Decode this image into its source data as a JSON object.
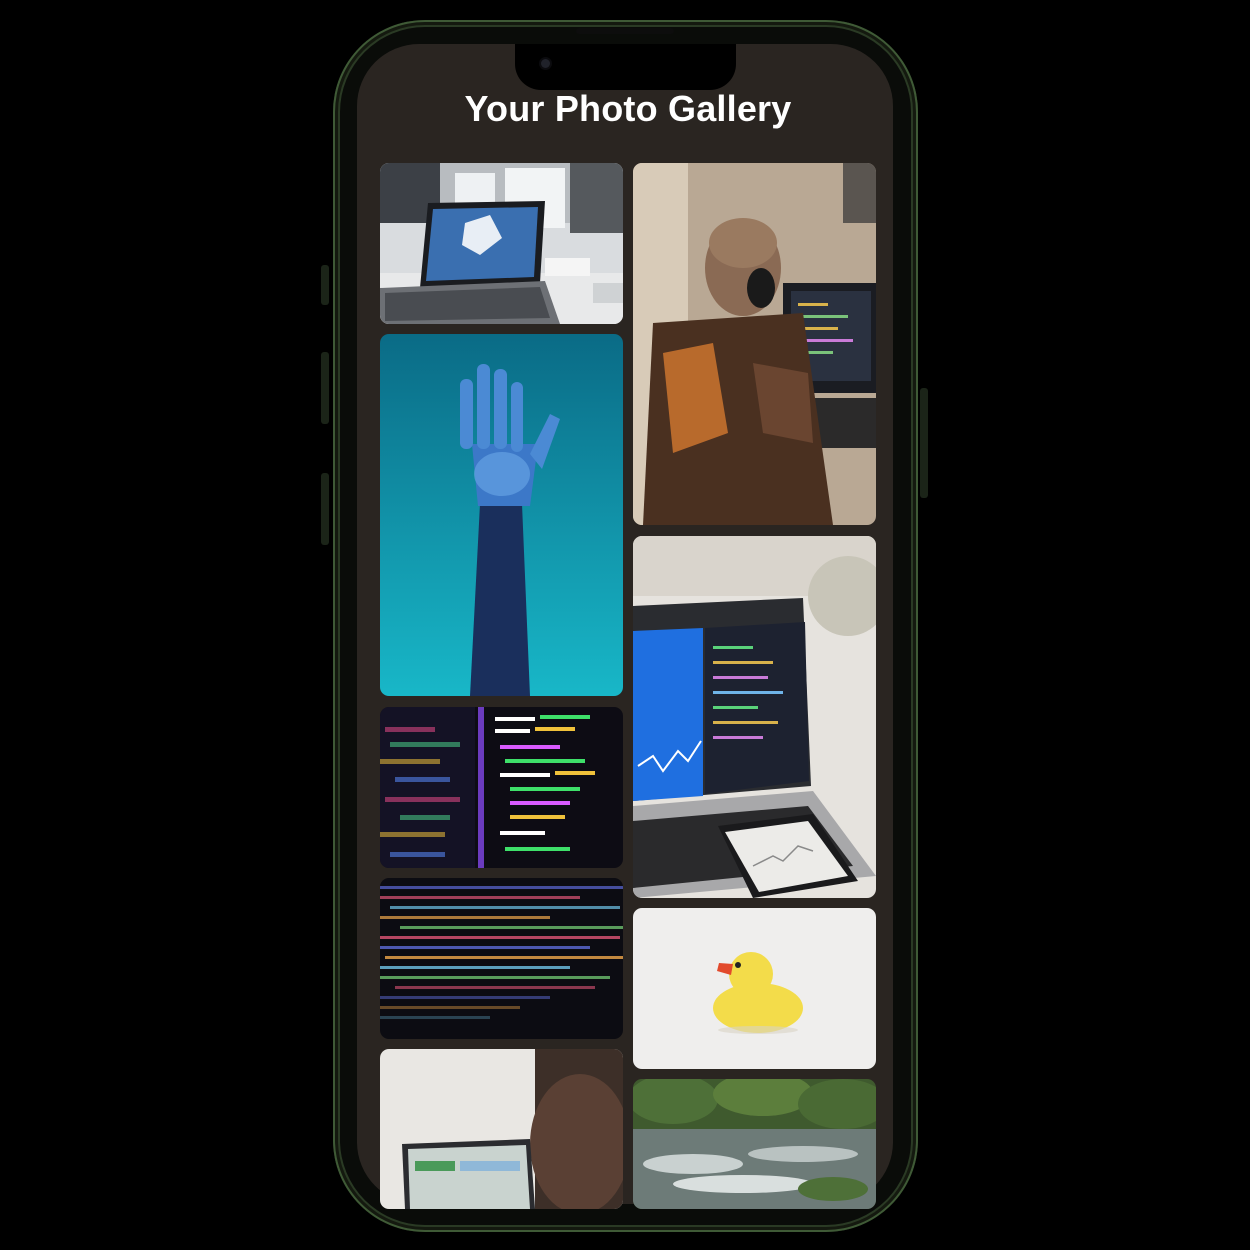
{
  "header": {
    "title": "Your Photo Gallery"
  },
  "gallery": {
    "photos": [
      {
        "icon": "laptop-desk-photo",
        "subject": "laptop on office desk"
      },
      {
        "icon": "raised-robot-hand-photo",
        "subject": "robotic hand raised against teal backdrop"
      },
      {
        "icon": "code-screen-photo",
        "subject": "colorful code on dark screen"
      },
      {
        "icon": "code-closeup-photo",
        "subject": "close-up of dense code lines"
      },
      {
        "icon": "person-laptop-photo",
        "subject": "person working at laptop"
      },
      {
        "icon": "developer-headphones-photo",
        "subject": "developer with headphones at monitors"
      },
      {
        "icon": "laptop-phone-chart-photo",
        "subject": "laptop and phone with finance charts"
      },
      {
        "icon": "rubber-duck-photo",
        "subject": "yellow rubber duck on white"
      },
      {
        "icon": "river-photo",
        "subject": "river rapids with greenery"
      }
    ]
  },
  "colors": {
    "screen_background": "#2a2521",
    "title_text": "#ffffff",
    "phone_frame": "#3f5a36"
  }
}
